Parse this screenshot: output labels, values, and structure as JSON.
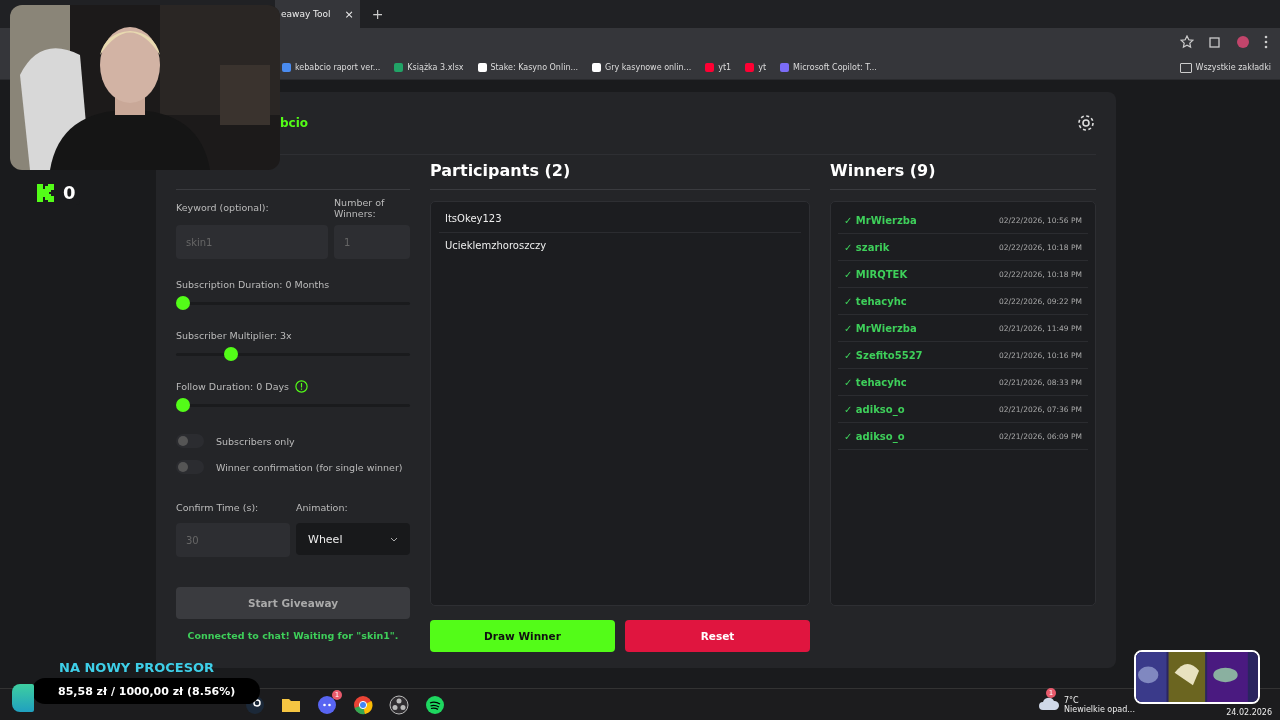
{
  "browser": {
    "tab_title": "eaway Tool",
    "tab_close": "×",
    "new_tab": "+",
    "bookmarks": [
      {
        "label": "kebabcio raport ver...",
        "kind": "doc"
      },
      {
        "label": "Książka 3.xlsx",
        "kind": "sheet"
      },
      {
        "label": "Stake: Kasyno Onlin...",
        "kind": "stake"
      },
      {
        "label": "Gry kasynowe onlin...",
        "kind": "stake"
      },
      {
        "label": "yt1",
        "kind": "yt"
      },
      {
        "label": "yt",
        "kind": "yt"
      },
      {
        "label": "Microsoft Copilot: T...",
        "kind": "copilot"
      }
    ],
    "all_bookmarks": "Wszystkie zakładki"
  },
  "app": {
    "title": "bcio",
    "settings": {
      "keyword_label": "Keyword (optional):",
      "keyword_placeholder": "skin1",
      "winners_label": "Number of Winners:",
      "winners_placeholder": "1",
      "sliders": [
        {
          "label": "Subscription Duration: 0 Months",
          "level": 0,
          "info": false
        },
        {
          "label": "Subscriber Multiplier: 3x",
          "level": 0.22,
          "info": false
        },
        {
          "label": "Follow Duration: 0 Days",
          "level": 0,
          "info": true
        }
      ],
      "toggles": [
        {
          "label": "Subscribers only",
          "on": false
        },
        {
          "label": "Winner confirmation (for single winner)",
          "on": false
        }
      ],
      "confirm_label": "Confirm Time (s):",
      "confirm_placeholder": "30",
      "animation_label": "Animation:",
      "animation_value": "Wheel",
      "start_button": "Start Giveaway",
      "status": "Connected to chat! Waiting for \"skin1\"."
    },
    "participants": {
      "title": "Participants (2)",
      "items": [
        "ItsOkey123",
        "Ucieklemzhoroszczy"
      ],
      "draw_button": "Draw Winner",
      "reset_button": "Reset"
    },
    "winners": {
      "title": "Winners (9)",
      "items": [
        {
          "name": "✓ MrWierzba",
          "time": "02/22/2026, 10:56 PM"
        },
        {
          "name": "✓ szarik",
          "time": "02/22/2026, 10:18 PM"
        },
        {
          "name": "✓ MIRQTEK",
          "time": "02/22/2026, 10:18 PM"
        },
        {
          "name": "✓ tehacyhc",
          "time": "02/22/2026, 09:22 PM"
        },
        {
          "name": "✓ MrWierzba",
          "time": "02/21/2026, 11:49 PM"
        },
        {
          "name": "✓ Szefito5527",
          "time": "02/21/2026, 10:16 PM"
        },
        {
          "name": "✓ tehacyhc",
          "time": "02/21/2026, 08:33 PM"
        },
        {
          "name": "✓ adikso_o",
          "time": "02/21/2026, 07:36 PM"
        },
        {
          "name": "✓ adikso_o",
          "time": "02/21/2026, 06:09 PM"
        }
      ]
    }
  },
  "overlay": {
    "viewer_count": "0",
    "goal_title": "NA NOWY PROCESOR",
    "goal_amount": "85,58 zł / 1000,00 zł (8.56%)"
  },
  "taskbar": {
    "apps": [
      {
        "kind": "steam"
      },
      {
        "kind": "folder"
      },
      {
        "kind": "discord",
        "badge": "1"
      },
      {
        "kind": "chrome"
      },
      {
        "kind": "obs"
      },
      {
        "kind": "spotify"
      }
    ],
    "weather_badge": "1",
    "temperature": "7°C",
    "weather": "Niewielkie opad...",
    "date": "24.02.2026"
  }
}
